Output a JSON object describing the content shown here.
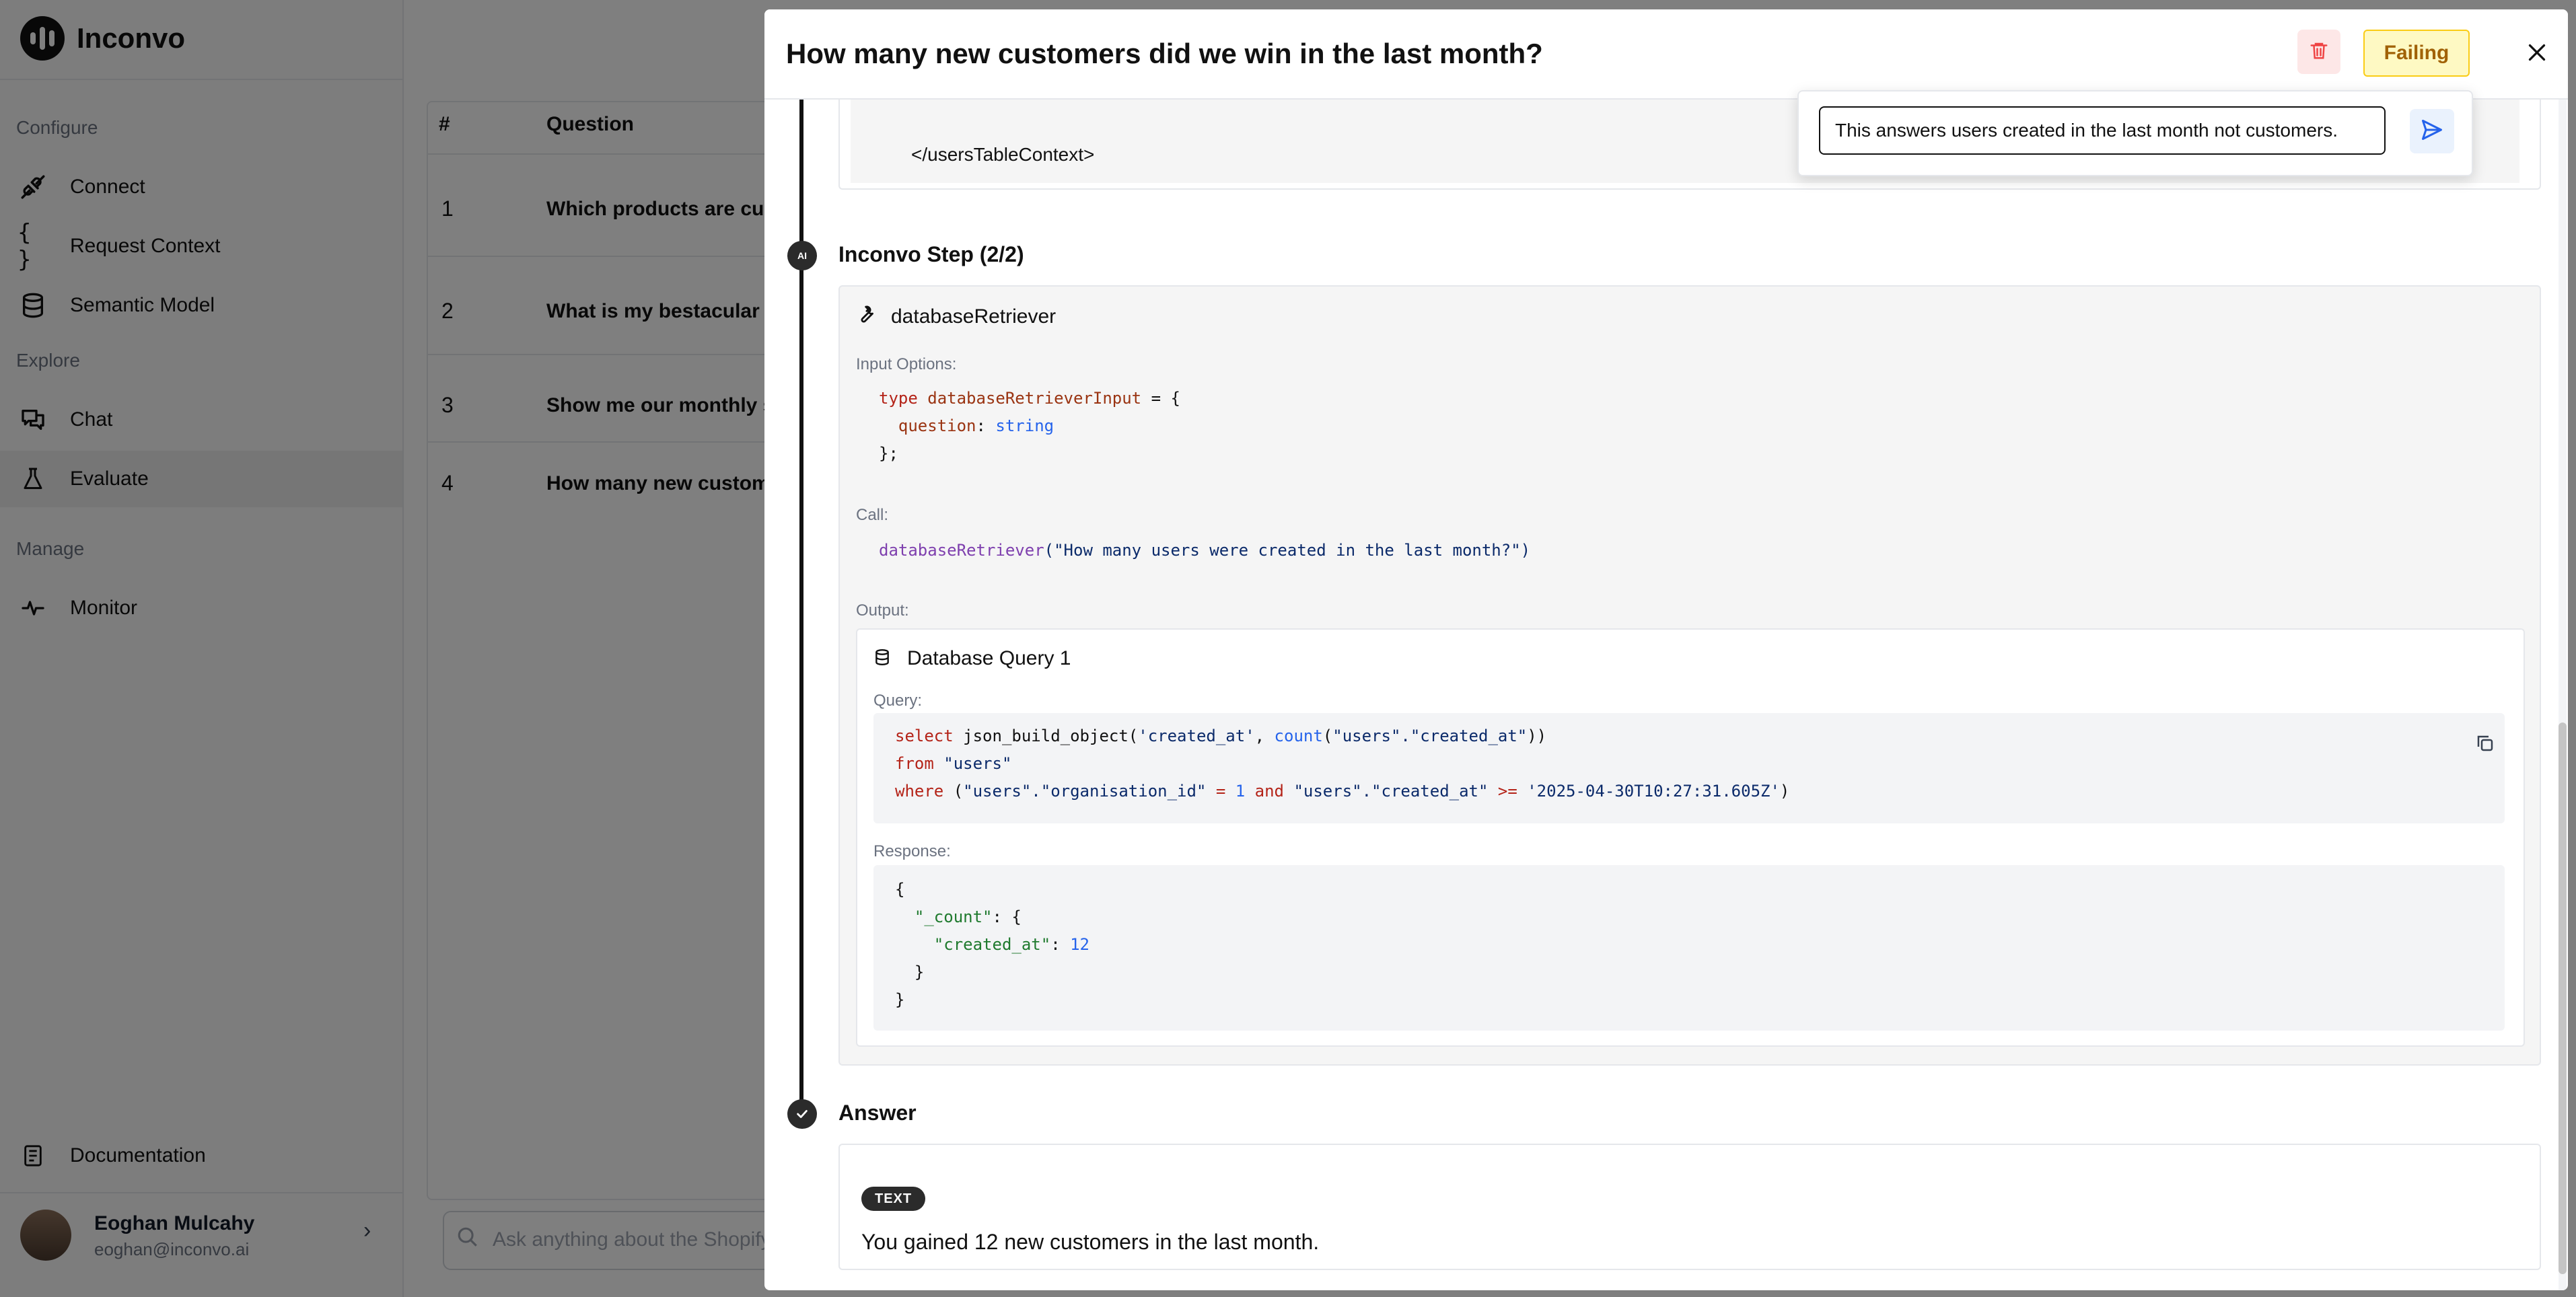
{
  "app": {
    "name": "Inconvo",
    "sections": [
      {
        "label": "Configure",
        "items": [
          {
            "label": "Connect",
            "icon": "plug-icon"
          },
          {
            "label": "Request Context",
            "icon": "braces-icon"
          },
          {
            "label": "Semantic Model",
            "icon": "database-icon"
          }
        ]
      },
      {
        "label": "Explore",
        "items": [
          {
            "label": "Chat",
            "icon": "chat-icon"
          },
          {
            "label": "Evaluate",
            "icon": "flask-icon",
            "active": true
          }
        ]
      },
      {
        "label": "Manage",
        "items": [
          {
            "label": "Monitor",
            "icon": "pulse-icon"
          }
        ]
      }
    ],
    "documentation_label": "Documentation",
    "user": {
      "name": "Eoghan Mulcahy",
      "email": "eoghan@inconvo.ai"
    },
    "table": {
      "headers": [
        "#",
        "Question"
      ],
      "rows": [
        {
          "num": "1",
          "question": "Which products are curr"
        },
        {
          "num": "2",
          "question": "What is my bestacular tr"
        },
        {
          "num": "3",
          "question": "Show me our monthly sa"
        },
        {
          "num": "4",
          "question": "How many new custome"
        }
      ]
    },
    "chat_placeholder": "Ask anything about the Shopify"
  },
  "modal": {
    "title": "How many new customers did we win in the last month?",
    "status": "Failing",
    "status_color": "#a16207",
    "feedback": {
      "value": "This answers users created in the last month not customers."
    },
    "context_close": "</usersTableContext>",
    "step": {
      "title": "Inconvo Step (2/2)",
      "dot_label": "AI",
      "tool_name": "databaseRetriever",
      "input_options_label": "Input Options:",
      "input_code": {
        "l1_kw": "type",
        "l1_name": "databaseRetrieverInput",
        "l1_rest": " = {",
        "l2_key": "question",
        "l2_type": "string",
        "l3": "};"
      },
      "call_label": "Call:",
      "call_fn": "databaseRetriever",
      "call_arg": "(\"How many users were created in the last month?\")",
      "output_label": "Output:",
      "db_query": {
        "title": "Database Query 1",
        "query_label": "Query:",
        "sql": {
          "l1_kw": "select",
          "l1_a": " json_build_object(",
          "l1_s1": "'created_at'",
          "l1_b": ", ",
          "l1_fn": "count",
          "l1_c": "(",
          "l1_s2": "\"users\".\"created_at\"",
          "l1_d": "))",
          "l2_kw": "from",
          "l2_s": " \"users\"",
          "l3_kw": "where",
          "l3_a": " (",
          "l3_s1": "\"users\".\"organisation_id\"",
          "l3_op": " = ",
          "l3_num": "1",
          "l3_and": " and ",
          "l3_s2": "\"users\".\"created_at\"",
          "l3_ge": " >= ",
          "l3_s3": "'2025-04-30T10:27:31.605Z'",
          "l3_end": ")"
        },
        "response_label": "Response:",
        "response": {
          "l1": "{",
          "l2_key": "\"_count\"",
          "l2_rest": ": {",
          "l3_key": "\"created_at\"",
          "l3_colon": ": ",
          "l3_val": "12",
          "l4": "}",
          "l5": "}"
        }
      }
    },
    "answer": {
      "title": "Answer",
      "badge": "TEXT",
      "text": "You gained 12 new customers in the last month."
    }
  }
}
